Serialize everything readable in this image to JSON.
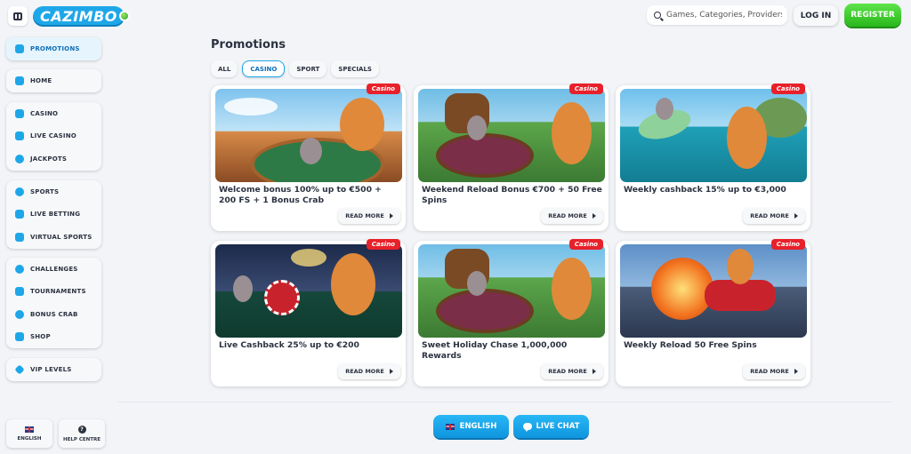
{
  "header": {
    "logo_text": "CAZIMBO",
    "search_placeholder": "Games, Categories, Providers",
    "login_label": "LOG IN",
    "register_label": "REGISTER"
  },
  "sidebar": {
    "groups": [
      [
        {
          "label": "PROMOTIONS",
          "icon": "gift-icon",
          "active": true
        }
      ],
      [
        {
          "label": "HOME",
          "icon": "home-icon"
        }
      ],
      [
        {
          "label": "CASINO",
          "icon": "slot-machine-icon"
        },
        {
          "label": "LIVE CASINO",
          "icon": "live-casino-icon"
        },
        {
          "label": "JACKPOTS",
          "icon": "jackpot-icon"
        }
      ],
      [
        {
          "label": "SPORTS",
          "icon": "ball-icon"
        },
        {
          "label": "LIVE BETTING",
          "icon": "play-icon"
        },
        {
          "label": "VIRTUAL SPORTS",
          "icon": "gamepad-icon"
        }
      ],
      [
        {
          "label": "CHALLENGES",
          "icon": "medal-icon"
        },
        {
          "label": "TOURNAMENTS",
          "icon": "trophy-icon"
        },
        {
          "label": "BONUS CRAB",
          "icon": "crab-icon"
        },
        {
          "label": "SHOP",
          "icon": "shop-icon"
        }
      ],
      [
        {
          "label": "VIP LEVELS",
          "icon": "diamond-icon"
        }
      ]
    ],
    "language_label": "ENGLISH",
    "help_label": "HELP CENTRE"
  },
  "main": {
    "title": "Promotions",
    "tabs": [
      "ALL",
      "CASINO",
      "SPORT",
      "SPECIALS"
    ],
    "active_tab": "CASINO",
    "cards": [
      {
        "badge": "Casino",
        "title": "Welcome bonus 100% up to €500 + 200 FS + 1 Bonus Crab",
        "button": "READ MORE"
      },
      {
        "badge": "Casino",
        "title": "Weekend Reload Bonus €700 + 50 Free Spins",
        "button": "READ MORE"
      },
      {
        "badge": "Casino",
        "title": "Weekly cashback 15% up to €3,000",
        "button": "READ MORE"
      },
      {
        "badge": "Casino",
        "title": "Live Cashback 25% up to €200",
        "button": "READ MORE"
      },
      {
        "badge": "Casino",
        "title": "Sweet Holiday Chase 1,000,000 Rewards",
        "button": "READ MORE"
      },
      {
        "badge": "Casino",
        "title": "Weekly Reload 50 Free Spins",
        "button": "READ MORE"
      }
    ]
  },
  "footer": {
    "language_label": "ENGLISH",
    "chat_label": "LIVE CHAT"
  },
  "colors": {
    "accent": "#1ea7e8",
    "register": "#29b71c",
    "badge": "#e8202a"
  }
}
